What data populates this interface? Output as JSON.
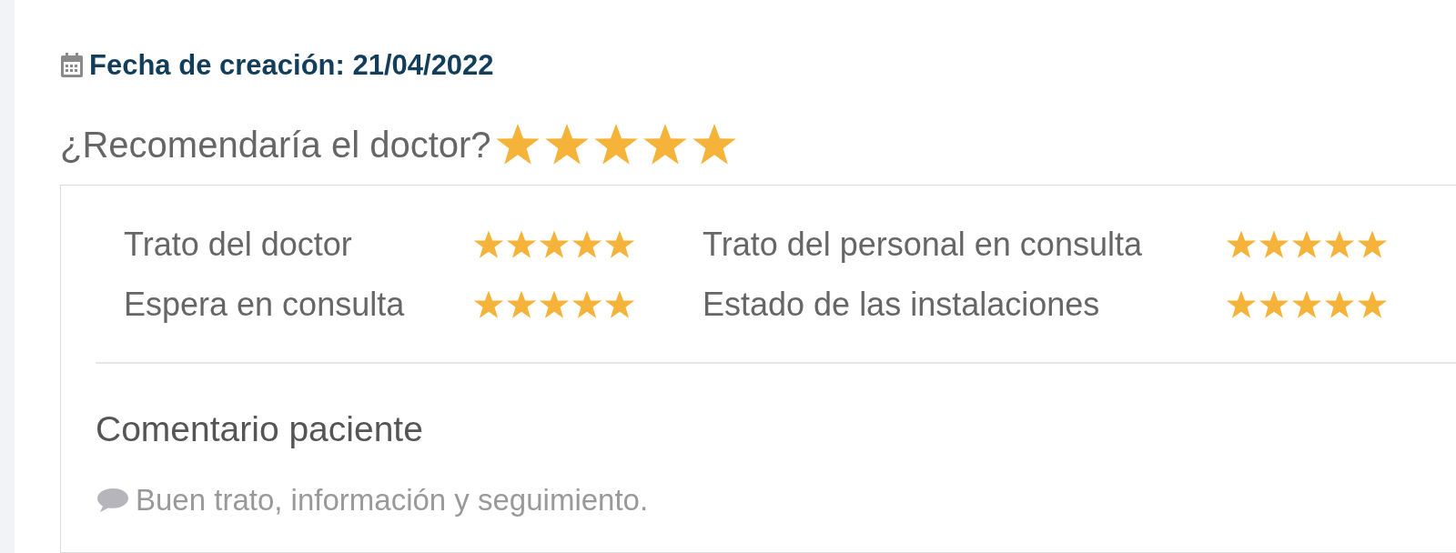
{
  "creation_date": {
    "label": "Fecha de creación: 21/04/2022"
  },
  "recommend": {
    "question": "¿Recomendaría el doctor?",
    "stars": 5
  },
  "ratings": [
    {
      "label": "Trato del doctor",
      "stars": 5
    },
    {
      "label": "Trato del personal en consulta",
      "stars": 5
    },
    {
      "label": "Espera en consulta",
      "stars": 5
    },
    {
      "label": "Estado de las instalaciones",
      "stars": 5
    }
  ],
  "comment": {
    "title": "Comentario paciente",
    "text": "Buen trato, información y seguimiento."
  }
}
